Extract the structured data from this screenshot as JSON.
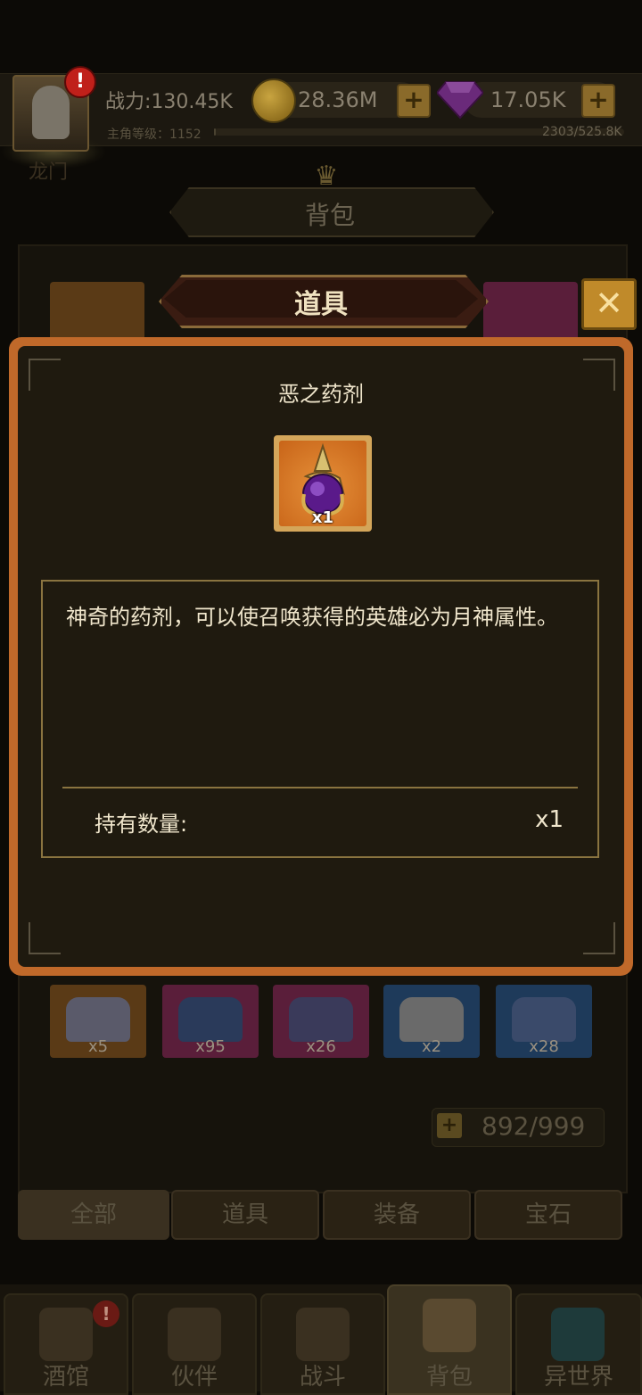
{
  "header": {
    "player_name": "龙门",
    "alert_badge": "!",
    "power": "战力:130.45K",
    "level": "主角等级：1152",
    "xp": "2303/525.8K",
    "xp_progress": 0.0044,
    "gold": "28.36M",
    "gems": "17.05K"
  },
  "bag": {
    "title": "背包",
    "capacity": "892/999",
    "filter_tabs": [
      "全部",
      "道具",
      "装备",
      "宝石"
    ],
    "bottom_row_counts": [
      "x5",
      "x95",
      "x26",
      "x2",
      "x28"
    ]
  },
  "popup": {
    "header_label": "道具",
    "item_name": "恶之药剂",
    "item_icon": "dark-potion-icon",
    "item_count": "x1",
    "description": "神奇的药剂，可以使召唤获得的英雄必为月神属性。",
    "quantity_label": "持有数量:",
    "quantity_value": "x1"
  },
  "nav": {
    "items": [
      "酒馆",
      "伙伴",
      "战斗",
      "背包",
      "异世界"
    ],
    "active": "背包",
    "alert_badge": "!"
  },
  "colors": {
    "dialog_frame": "#c0692a",
    "dialog_bg": "#1f1a0f",
    "gold_accent": "#8a7440",
    "text_light": "#f0e6cc"
  }
}
